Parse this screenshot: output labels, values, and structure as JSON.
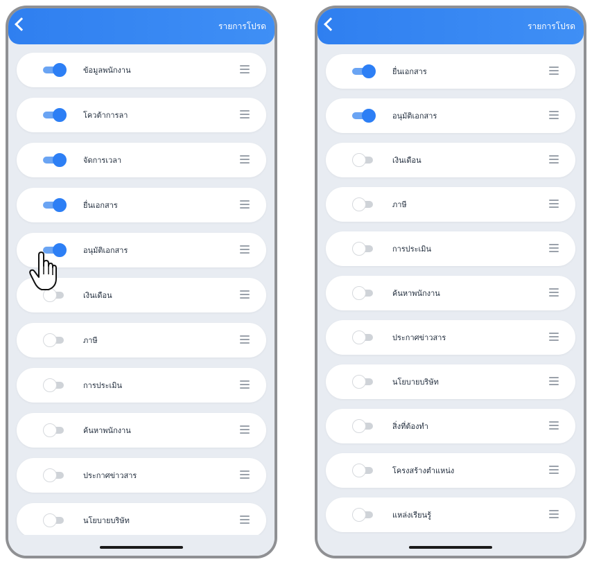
{
  "left_screen": {
    "header_title": "รายการโปรด",
    "items": [
      {
        "label": "ข้อมูลพนักงาน",
        "enabled": true
      },
      {
        "label": "โควต้าการลา",
        "enabled": true
      },
      {
        "label": "จัดการเวลา",
        "enabled": true
      },
      {
        "label": "ยื่นเอกสาร",
        "enabled": true
      },
      {
        "label": "อนุมัติเอกสาร",
        "enabled": true
      },
      {
        "label": "เงินเดือน",
        "enabled": false
      },
      {
        "label": "ภาษี",
        "enabled": false
      },
      {
        "label": "การประเมิน",
        "enabled": false
      },
      {
        "label": "ค้นหาพนักงาน",
        "enabled": false
      },
      {
        "label": "ประกาศข่าวสาร",
        "enabled": false
      },
      {
        "label": "นโยบายบริษัท",
        "enabled": false
      }
    ]
  },
  "right_screen": {
    "header_title": "รายการโปรด",
    "items": [
      {
        "label": "ยื่นเอกสาร",
        "enabled": true
      },
      {
        "label": "อนุมัติเอกสาร",
        "enabled": true
      },
      {
        "label": "เงินเดือน",
        "enabled": false
      },
      {
        "label": "ภาษี",
        "enabled": false
      },
      {
        "label": "การประเมิน",
        "enabled": false
      },
      {
        "label": "ค้นหาพนักงาน",
        "enabled": false
      },
      {
        "label": "ประกาศข่าวสาร",
        "enabled": false
      },
      {
        "label": "นโยบายบริษัท",
        "enabled": false
      },
      {
        "label": "สิ่งที่ต้องทำ",
        "enabled": false
      },
      {
        "label": "โครงสร้างตำแหน่ง",
        "enabled": false
      },
      {
        "label": "แหล่งเรียนรู้",
        "enabled": false
      }
    ]
  },
  "colors": {
    "accent": "#2d7ff5",
    "header": "#3385f2",
    "background": "#e8ecf2"
  },
  "icons": {
    "back": "chevron-left-icon",
    "drag": "drag-handle-icon",
    "cursor": "hand-pointer-icon"
  }
}
